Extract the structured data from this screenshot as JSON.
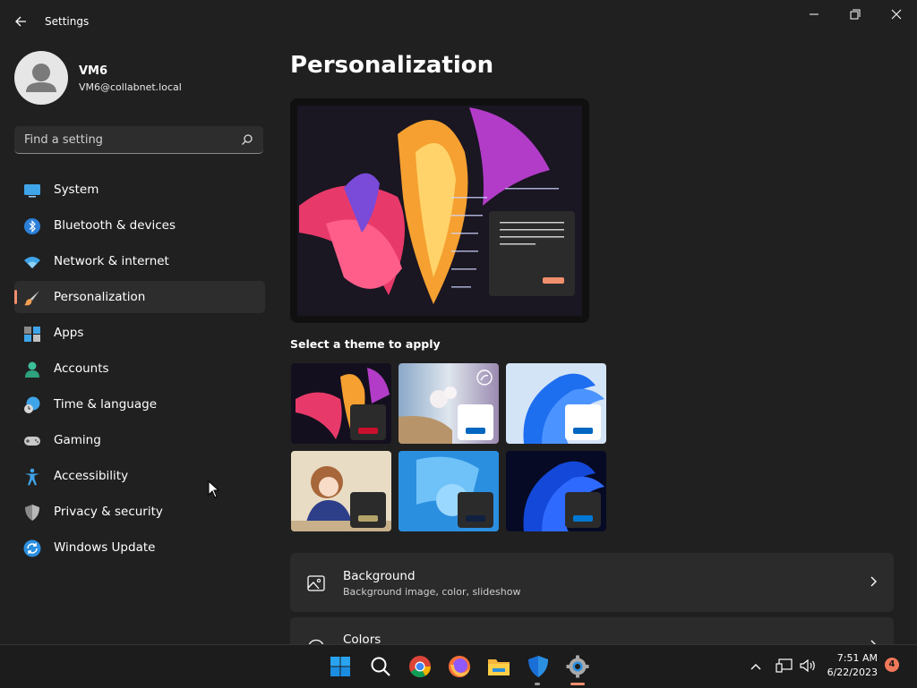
{
  "window": {
    "title": "Settings"
  },
  "user": {
    "name": "VM6",
    "email": "VM6@collabnet.local"
  },
  "search": {
    "placeholder": "Find a setting"
  },
  "sidebar": {
    "items": [
      {
        "label": "System",
        "icon": "monitor-icon"
      },
      {
        "label": "Bluetooth & devices",
        "icon": "bluetooth-icon"
      },
      {
        "label": "Network & internet",
        "icon": "wifi-icon"
      },
      {
        "label": "Personalization",
        "icon": "paintbrush-icon",
        "active": true
      },
      {
        "label": "Apps",
        "icon": "apps-icon"
      },
      {
        "label": "Accounts",
        "icon": "person-icon"
      },
      {
        "label": "Time & language",
        "icon": "globe-clock-icon"
      },
      {
        "label": "Gaming",
        "icon": "gamepad-icon"
      },
      {
        "label": "Accessibility",
        "icon": "accessibility-icon"
      },
      {
        "label": "Privacy & security",
        "icon": "shield-icon"
      },
      {
        "label": "Windows Update",
        "icon": "update-icon"
      }
    ]
  },
  "main": {
    "title": "Personalization",
    "themes_label": "Select a theme to apply",
    "cards": [
      {
        "title": "Background",
        "subtitle": "Background image, color, slideshow",
        "icon": "image-icon"
      },
      {
        "title": "Colors",
        "subtitle": "",
        "icon": "palette-icon"
      }
    ]
  },
  "colors": {
    "accent": "#f08f6e",
    "background": "#202020",
    "card": "#2b2b2b"
  },
  "taskbar": {
    "apps": [
      "windows-start-icon",
      "search-icon",
      "chrome-icon",
      "firefox-icon",
      "file-explorer-icon",
      "defender-icon",
      "settings-icon"
    ],
    "time": "7:51 AM",
    "date": "6/22/2023",
    "notifications": "4"
  }
}
